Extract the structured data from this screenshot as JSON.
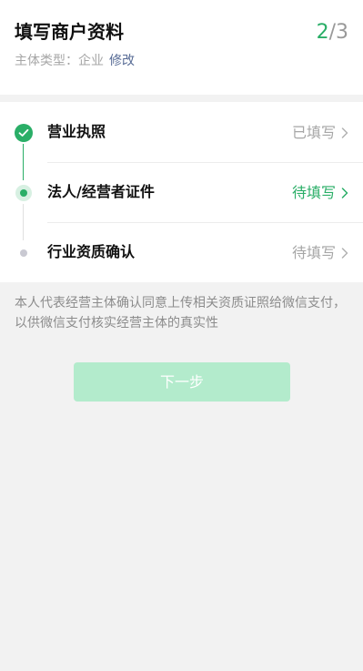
{
  "header": {
    "title": "填写商户资料",
    "step_current": "2",
    "step_total": "/3",
    "subject_type_label": "主体类型：",
    "subject_type_value": "企业",
    "edit_label": "修改"
  },
  "steps": [
    {
      "label": "营业执照",
      "status": "已填写",
      "state": "done"
    },
    {
      "label": "法人/经营者证件",
      "status": "待填写",
      "state": "current"
    },
    {
      "label": "行业资质确认",
      "status": "待填写",
      "state": "pending"
    }
  ],
  "notice": "本人代表经营主体确认同意上传相关资质证照给微信支付，以供微信支付核实经营主体的真实性",
  "next_button": {
    "label": "下一步",
    "enabled": false
  },
  "colors": {
    "accent_green": "#2aae67",
    "button_disabled_bg": "#b3ebcc",
    "link_blue": "#576b95"
  },
  "icons": {
    "done": "check-circle-icon",
    "current": "current-step-dot-icon",
    "pending": "pending-step-dot-icon",
    "chevron": "chevron-right-icon"
  }
}
